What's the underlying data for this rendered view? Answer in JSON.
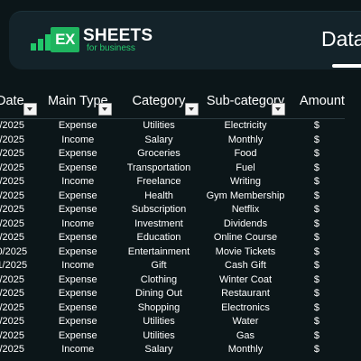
{
  "banner": {
    "logo_box_text": "EX",
    "logo_name": "SHEETS",
    "logo_sub": "for business",
    "page_title": "Data",
    "colors": {
      "brand_green": "#1fb45f",
      "background": "#0c1619",
      "card": "#14232a"
    }
  },
  "table": {
    "headers": [
      "Date",
      "Main Type",
      "Category",
      "Sub-category",
      "Amount"
    ],
    "rows": [
      [
        "/2025",
        "Expense",
        "Utilities",
        "Electricity",
        "$"
      ],
      [
        "/2025",
        "Income",
        "Salary",
        "Monthly",
        "$"
      ],
      [
        "/2025",
        "Expense",
        "Groceries",
        "Food",
        "$"
      ],
      [
        "/2025",
        "Expense",
        "Transportation",
        "Fuel",
        "$"
      ],
      [
        "/2025",
        "Income",
        "Freelance",
        "Writing",
        "$"
      ],
      [
        "/2025",
        "Expense",
        "Health",
        "Gym Membership",
        "$"
      ],
      [
        "/2025",
        "Expense",
        "Subscription",
        "Netflix",
        "$"
      ],
      [
        "/2025",
        "Income",
        "Investment",
        "Dividends",
        "$"
      ],
      [
        "/2025",
        "Expense",
        "Education",
        "Online Course",
        "$"
      ],
      [
        "0/2025",
        "Expense",
        "Entertainment",
        "Movie Tickets",
        "$"
      ],
      [
        "1/2025",
        "Income",
        "Gift",
        "Cash Gift",
        "$"
      ],
      [
        "/2025",
        "Expense",
        "Clothing",
        "Winter Coat",
        "$"
      ],
      [
        "/2025",
        "Expense",
        "Dining Out",
        "Restaurant",
        "$"
      ],
      [
        "/2025",
        "Expense",
        "Shopping",
        "Electronics",
        "$"
      ],
      [
        "/2025",
        "Expense",
        "Utilities",
        "Water",
        "$"
      ],
      [
        "/2025",
        "Expense",
        "Utilities",
        "Gas",
        "$"
      ],
      [
        "/2025",
        "Income",
        "Salary",
        "Monthly",
        "$"
      ]
    ]
  }
}
